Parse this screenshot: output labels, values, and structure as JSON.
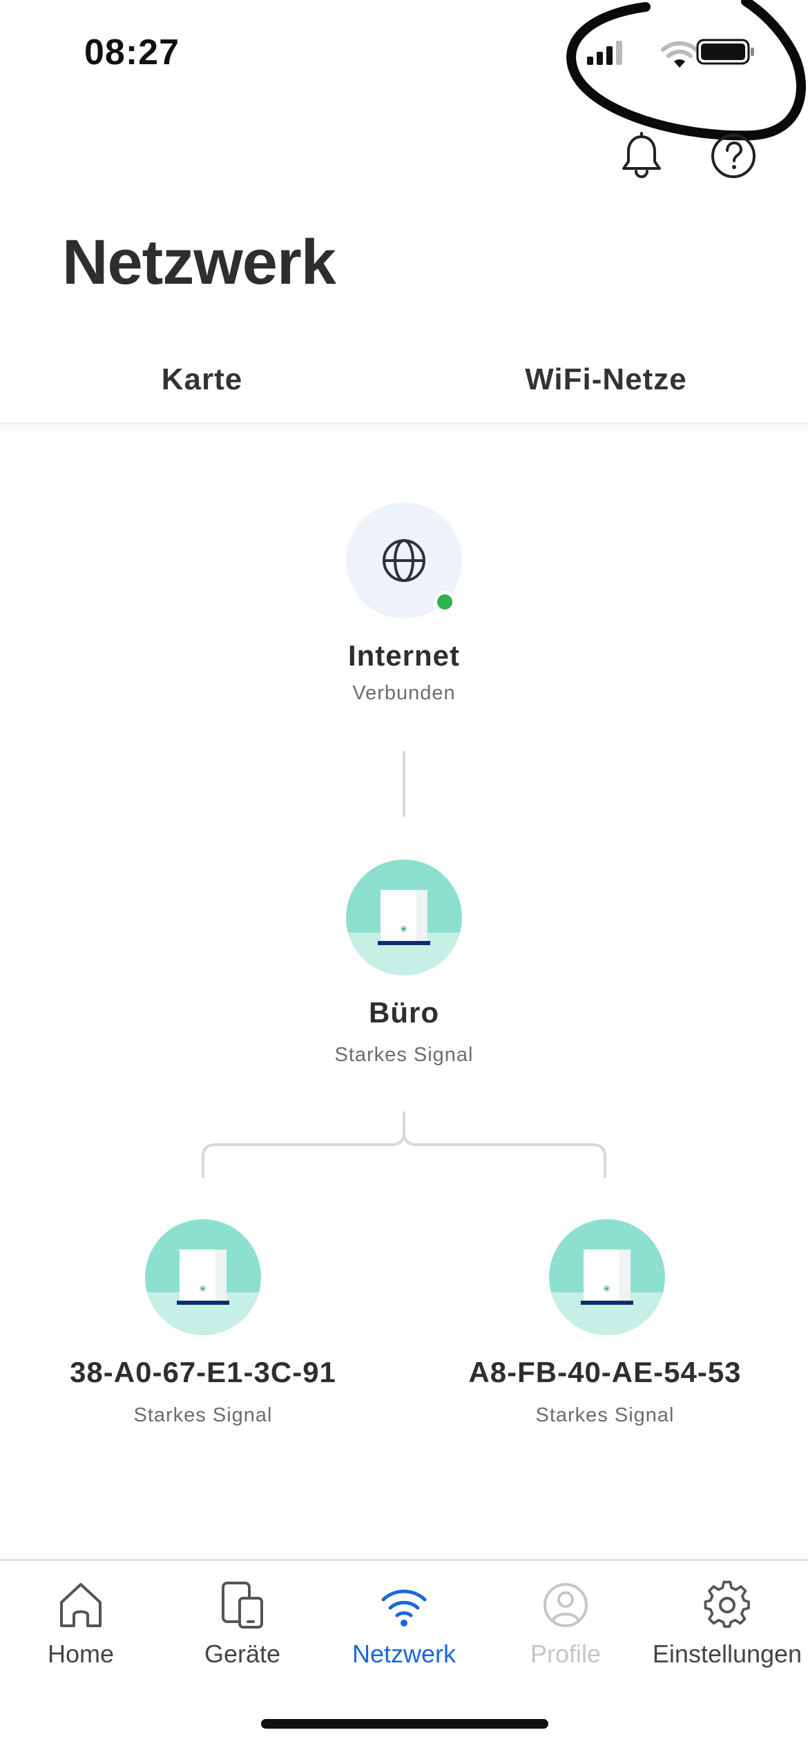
{
  "status_bar": {
    "time": "08:27",
    "icons": [
      "cellular-signal-icon",
      "wifi-icon",
      "battery-icon"
    ]
  },
  "header": {
    "actions": [
      "bell-icon",
      "help-icon"
    ],
    "title": "Netzwerk"
  },
  "tabs": [
    {
      "label": "Karte",
      "active": true
    },
    {
      "label": "WiFi-Netze",
      "active": false
    }
  ],
  "network_map": {
    "internet": {
      "name": "Internet",
      "status": "Verbunden",
      "icon": "globe-icon",
      "status_color": "#2db24d"
    },
    "main_node": {
      "name": "Büro",
      "status": "Starkes Signal",
      "icon": "router-icon"
    },
    "child_nodes": [
      {
        "name": "38-A0-67-E1-3C-91",
        "status": "Starkes Signal",
        "icon": "router-icon"
      },
      {
        "name": "A8-FB-40-AE-54-53",
        "status": "Starkes Signal",
        "icon": "router-icon"
      }
    ]
  },
  "bottom_nav": [
    {
      "label": "Home",
      "icon": "home-icon",
      "state": "normal"
    },
    {
      "label": "Geräte",
      "icon": "devices-icon",
      "state": "normal"
    },
    {
      "label": "Netzwerk",
      "icon": "wifi-icon",
      "state": "active"
    },
    {
      "label": "Profile",
      "icon": "profile-icon",
      "state": "disabled"
    },
    {
      "label": "Einstellungen",
      "icon": "gear-icon",
      "state": "normal"
    }
  ],
  "colors": {
    "accent": "#1a66d9",
    "node_teal": "#8de0cf",
    "node_teal_light": "#c6efe6",
    "online": "#2db24d"
  }
}
